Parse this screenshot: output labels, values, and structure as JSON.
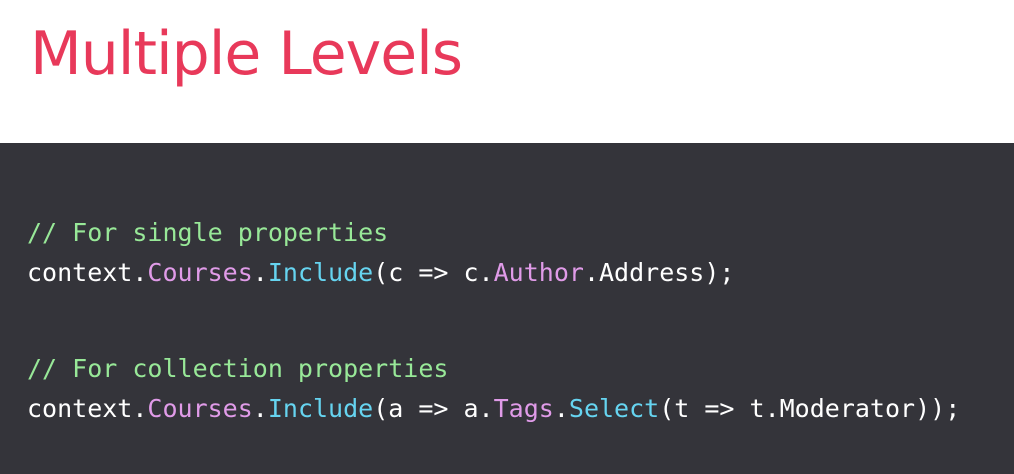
{
  "slide": {
    "title": "Multiple Levels",
    "colors": {
      "title": "#e8395a",
      "code_background": "#34343a",
      "comment": "#98e898",
      "plain": "#ffffff",
      "member": "#e09be8",
      "method": "#66d4f0"
    }
  },
  "code": {
    "single": {
      "comment": "// For single properties",
      "t1": "context.",
      "t2": "Courses",
      "t3": ".",
      "t4": "Include",
      "t5": "(c => c.",
      "t6": "Author",
      "t7": ".Address);"
    },
    "collection": {
      "comment": "// For collection properties",
      "t1": "context.",
      "t2": "Courses",
      "t3": ".",
      "t4": "Include",
      "t5": "(a => a.",
      "t6": "Tags",
      "t7": ".",
      "t8": "Select",
      "t9": "(t => t.Moderator));"
    }
  }
}
